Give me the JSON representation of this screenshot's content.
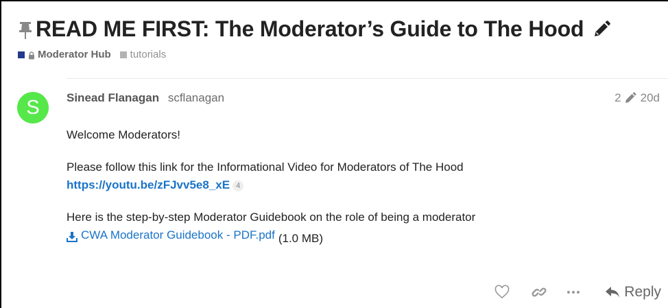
{
  "topic": {
    "title": "READ ME FIRST: The Moderator’s Guide to The Hood"
  },
  "breadcrumb": {
    "category": "Moderator Hub",
    "category_color": "#25398d",
    "tag": "tutorials",
    "tag_color": "#b3b3b3"
  },
  "post": {
    "author_avatar_letter": "S",
    "author_avatar_color": "#56e74a",
    "author_fullname": "Sinead Flanagan",
    "author_username": "scflanagan",
    "edit_count": "2",
    "age": "20d",
    "paragraph1": "Welcome Moderators!",
    "paragraph2": "Please follow this link for the Informational Video for Moderators of The Hood",
    "video_link": "https://youtu.be/zFJvv5e8_xE",
    "video_link_clicks": "4",
    "paragraph3": "Here is the step-by-step Moderator Guidebook on the role of being a moderator",
    "attachment_name": "CWA Moderator Guidebook - PDF.pdf",
    "attachment_size": "(1.0 MB)"
  },
  "actions": {
    "reply_label": "Reply",
    "icons": [
      "heart-icon",
      "link-icon",
      "more-icon",
      "reply-icon"
    ]
  },
  "colors": {
    "link": "#1a73c8",
    "muted": "#888888"
  }
}
